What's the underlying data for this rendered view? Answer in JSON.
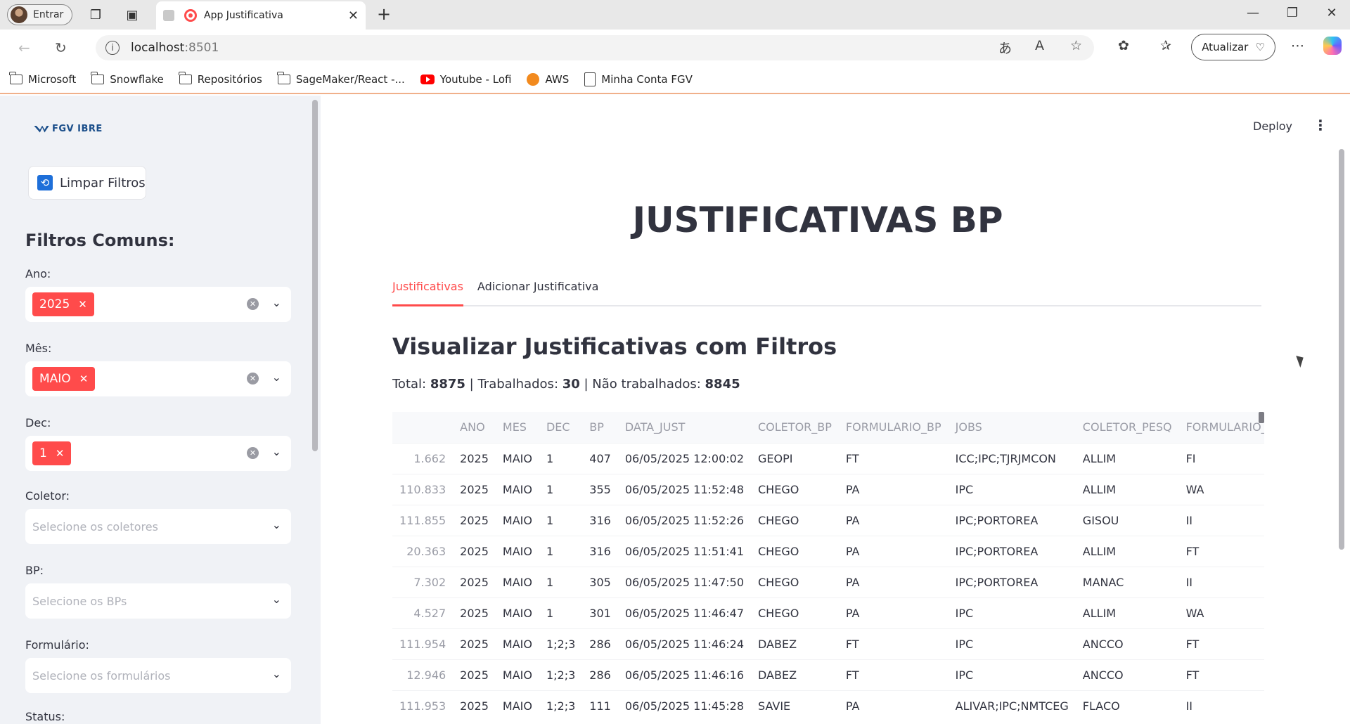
{
  "browser": {
    "profile_label": "Entrar",
    "tab_title": "App Justificativa",
    "url_host": "localhost",
    "url_port": ":8501",
    "update_label": "Atualizar",
    "bookmarks": [
      {
        "label": "Microsoft",
        "icon": "folder-icon"
      },
      {
        "label": "Snowflake",
        "icon": "folder-icon"
      },
      {
        "label": "Repositórios",
        "icon": "folder-icon"
      },
      {
        "label": "SageMaker/React -...",
        "icon": "folder-icon"
      },
      {
        "label": "Youtube - Lofi",
        "icon": "youtube-icon"
      },
      {
        "label": "AWS",
        "icon": "aws-icon"
      },
      {
        "label": "Minha Conta FGV",
        "icon": "fgv-icon"
      }
    ]
  },
  "sidebar": {
    "logo_text": "FGV IBRE",
    "clear_button": "Limpar Filtros",
    "heading": "Filtros Comuns:",
    "filters": {
      "ano": {
        "label": "Ano:",
        "chip": "2025"
      },
      "mes": {
        "label": "Mês:",
        "chip": "MAIO"
      },
      "dec": {
        "label": "Dec:",
        "chip": "1"
      },
      "coletor": {
        "label": "Coletor:",
        "placeholder": "Selecione os coletores"
      },
      "bp": {
        "label": "BP:",
        "placeholder": "Selecione os BPs"
      },
      "formulario": {
        "label": "Formulário:",
        "placeholder": "Selecione os formulários"
      },
      "status": {
        "label": "Status:"
      }
    }
  },
  "main": {
    "deploy_label": "Deploy",
    "title": "JUSTIFICATIVAS BP",
    "tabs": [
      "Justificativas",
      "Adicionar Justificativa"
    ],
    "subtitle": "Visualizar Justificativas com Filtros",
    "totals": {
      "total_label": "Total: ",
      "total_value": "8875",
      "worked_label": " | Trabalhados: ",
      "worked_value": "30",
      "not_worked_label": " | Não trabalhados: ",
      "not_worked_value": "8845"
    },
    "table": {
      "columns": [
        "",
        "ANO",
        "MES",
        "DEC",
        "BP",
        "DATA_JUST",
        "COLETOR_BP",
        "FORMULARIO_BP",
        "JOBS",
        "COLETOR_PESQ",
        "FORMULARIO_PESQ"
      ],
      "rows": [
        [
          "1.662",
          "2025",
          "MAIO",
          "1",
          "407",
          "06/05/2025 12:00:02",
          "GEOPI",
          "FT",
          "ICC;IPC;TJRJMCON",
          "ALLIM",
          "FI"
        ],
        [
          "110.833",
          "2025",
          "MAIO",
          "1",
          "355",
          "06/05/2025 11:52:48",
          "CHEGO",
          "PA",
          "IPC",
          "ALLIM",
          "WA"
        ],
        [
          "111.855",
          "2025",
          "MAIO",
          "1",
          "316",
          "06/05/2025 11:52:26",
          "CHEGO",
          "PA",
          "IPC;PORTOREA",
          "GISOU",
          "II"
        ],
        [
          "20.363",
          "2025",
          "MAIO",
          "1",
          "316",
          "06/05/2025 11:51:41",
          "CHEGO",
          "PA",
          "IPC;PORTOREA",
          "ALLIM",
          "FT"
        ],
        [
          "7.302",
          "2025",
          "MAIO",
          "1",
          "305",
          "06/05/2025 11:47:50",
          "CHEGO",
          "PA",
          "IPC;PORTOREA",
          "MANAC",
          "II"
        ],
        [
          "4.527",
          "2025",
          "MAIO",
          "1",
          "301",
          "06/05/2025 11:46:47",
          "CHEGO",
          "PA",
          "IPC",
          "ALLIM",
          "WA"
        ],
        [
          "111.954",
          "2025",
          "MAIO",
          "1;2;3",
          "286",
          "06/05/2025 11:46:24",
          "DABEZ",
          "FT",
          "IPC",
          "ANCCO",
          "FT"
        ],
        [
          "12.946",
          "2025",
          "MAIO",
          "1;2;3",
          "286",
          "06/05/2025 11:46:16",
          "DABEZ",
          "FT",
          "IPC",
          "ANCCO",
          "FT"
        ],
        [
          "111.953",
          "2025",
          "MAIO",
          "1;2;3",
          "111",
          "06/05/2025 11:45:28",
          "SAVIE",
          "PA",
          "ALIVAR;IPC;NMTCEG",
          "FLACO",
          "II"
        ]
      ]
    }
  },
  "colors": {
    "accent": "#ff4b4b",
    "sidebar_bg": "#f0f2f6",
    "text": "#31333f"
  }
}
